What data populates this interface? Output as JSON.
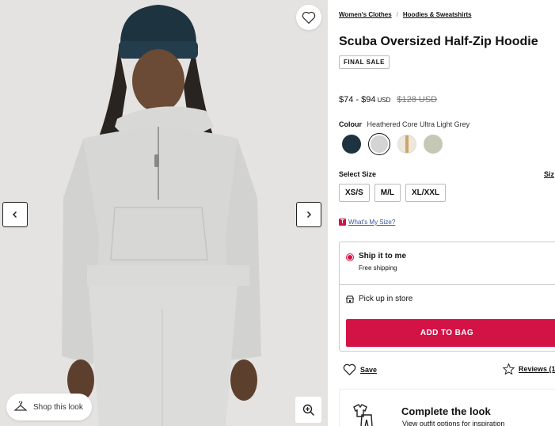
{
  "gallery": {
    "shop_look_label": "Shop this look",
    "icons": {
      "favorite": "heart-icon",
      "prev": "chevron-left-icon",
      "next": "chevron-right-icon",
      "zoom": "zoom-in-icon",
      "shop_look": "hanger-icon"
    }
  },
  "breadcrumb": [
    "Women's Clothes",
    "Hoodies & Sweatshirts"
  ],
  "breadcrumb_separator": "/",
  "product": {
    "title": "Scuba Oversized Half-Zip Hoodie",
    "badge": "FINAL SALE",
    "price_range": "$74 - $94",
    "currency": "USD",
    "original_price": "$128 USD"
  },
  "colour": {
    "label": "Colour",
    "selected_name": "Heathered Core Ultra Light Grey",
    "swatches": [
      {
        "color": "#1e3340",
        "selected": false
      },
      {
        "color": "#d4d4d4",
        "selected": true
      },
      {
        "color": "#efe7da",
        "selected": false,
        "stripe": "#c9a66b"
      },
      {
        "color": "#c5c8b5",
        "selected": false
      }
    ]
  },
  "size": {
    "label": "Select Size",
    "guide": "Siz",
    "options": [
      "XS/S",
      "M/L",
      "XL/XXL"
    ]
  },
  "whats_my_size": {
    "badge": "T",
    "label": "What's My Size?"
  },
  "shipping": {
    "option1_title": "Ship it to me",
    "option1_sub": "Free shipping",
    "option2_title": "Pick up in store"
  },
  "cta": {
    "add_to_bag": "ADD TO BAG"
  },
  "actions": {
    "save": "Save",
    "reviews": "Reviews (1"
  },
  "complete_look": {
    "title": "Complete the look",
    "subtitle": "View outfit options for inspiration"
  },
  "colors": {
    "accent": "#d31245",
    "background_gallery": "#e4e3e1",
    "beanie": "#1e3340"
  }
}
